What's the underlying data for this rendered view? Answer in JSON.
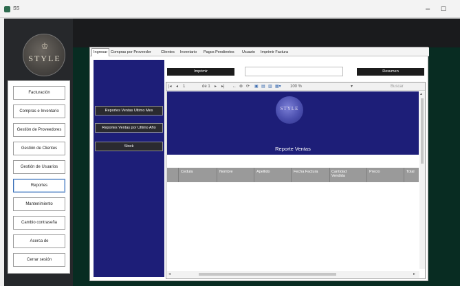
{
  "window": {
    "title": "SS"
  },
  "brand": {
    "logo_text": "STYLE"
  },
  "menu": {
    "items": [
      {
        "label": "Facturación"
      },
      {
        "label": "Compras e Inventario"
      },
      {
        "label": "Gestión de Proveedores"
      },
      {
        "label": "Gestión de Clientes"
      },
      {
        "label": "Gestión de Usuarios"
      },
      {
        "label": "Reportes"
      },
      {
        "label": "Mantenimiento"
      },
      {
        "label": "Cambio contraseña"
      },
      {
        "label": "Acerca de"
      },
      {
        "label": "Cerrar sesión"
      }
    ],
    "active_index": 5
  },
  "tabs": [
    {
      "label": "Ingresar"
    },
    {
      "label": "Compras por Proveedor"
    },
    {
      "label": "Clientes"
    },
    {
      "label": "Inventario"
    },
    {
      "label": "Pagos Pendientes"
    },
    {
      "label": "Usuario"
    },
    {
      "label": "Imprimir Factura"
    }
  ],
  "reports": {
    "items": [
      {
        "label": "Reportes Ventas Ultimo Mes"
      },
      {
        "label": "Reportes Ventas por Ultimo Año"
      },
      {
        "label": "Stock"
      }
    ]
  },
  "actions": {
    "imprimir_label": "Imprimir",
    "resumen_label": "Resumen",
    "search_value": ""
  },
  "viewer": {
    "page_current": "1",
    "page_total": "de 1",
    "zoom": "100 %",
    "find_label": "Buscar",
    "report_logo_text": "STYLE",
    "report_title": "Reporte Ventas",
    "columns": [
      "Cedula",
      "Nombre",
      "Apellido",
      "Fecha Factura",
      "Cantidad Vendida",
      "Precio",
      "Total"
    ]
  },
  "colors": {
    "app_background": "#082c22",
    "report_panel": "#1d1e78",
    "button_dark": "#1c1c1c",
    "table_header": "#9a9a9a"
  }
}
